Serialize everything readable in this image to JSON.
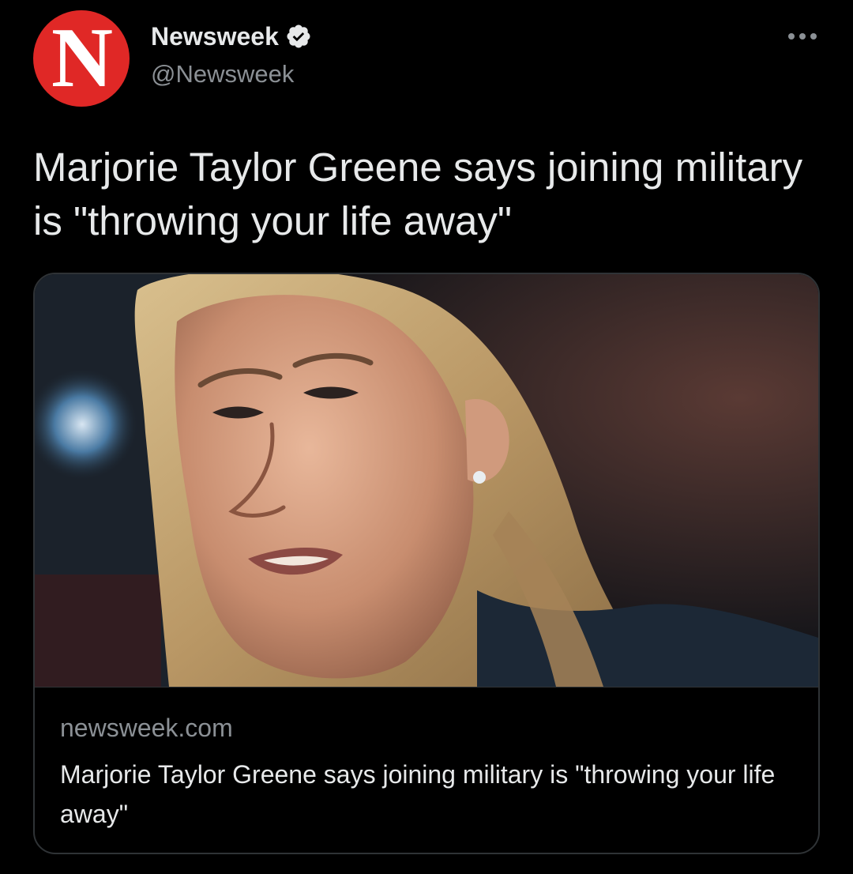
{
  "tweet": {
    "author": {
      "avatar_letter": "N",
      "display_name": "Newsweek",
      "handle": "@Newsweek",
      "verified": true,
      "avatar_color": "#e02826",
      "verified_color": "#e7e9ea"
    },
    "more_icon": "more-horizontal-icon",
    "headline": "Marjorie Taylor Greene says joining military is \"throwing your life away\"",
    "card": {
      "domain": "newsweek.com",
      "title": "Marjorie Taylor Greene says joining military is \"throwing your life away\""
    }
  },
  "theme": {
    "background": "#000000",
    "text_primary": "#e7e9ea",
    "text_secondary": "#8b9095",
    "border": "#2f3336"
  }
}
